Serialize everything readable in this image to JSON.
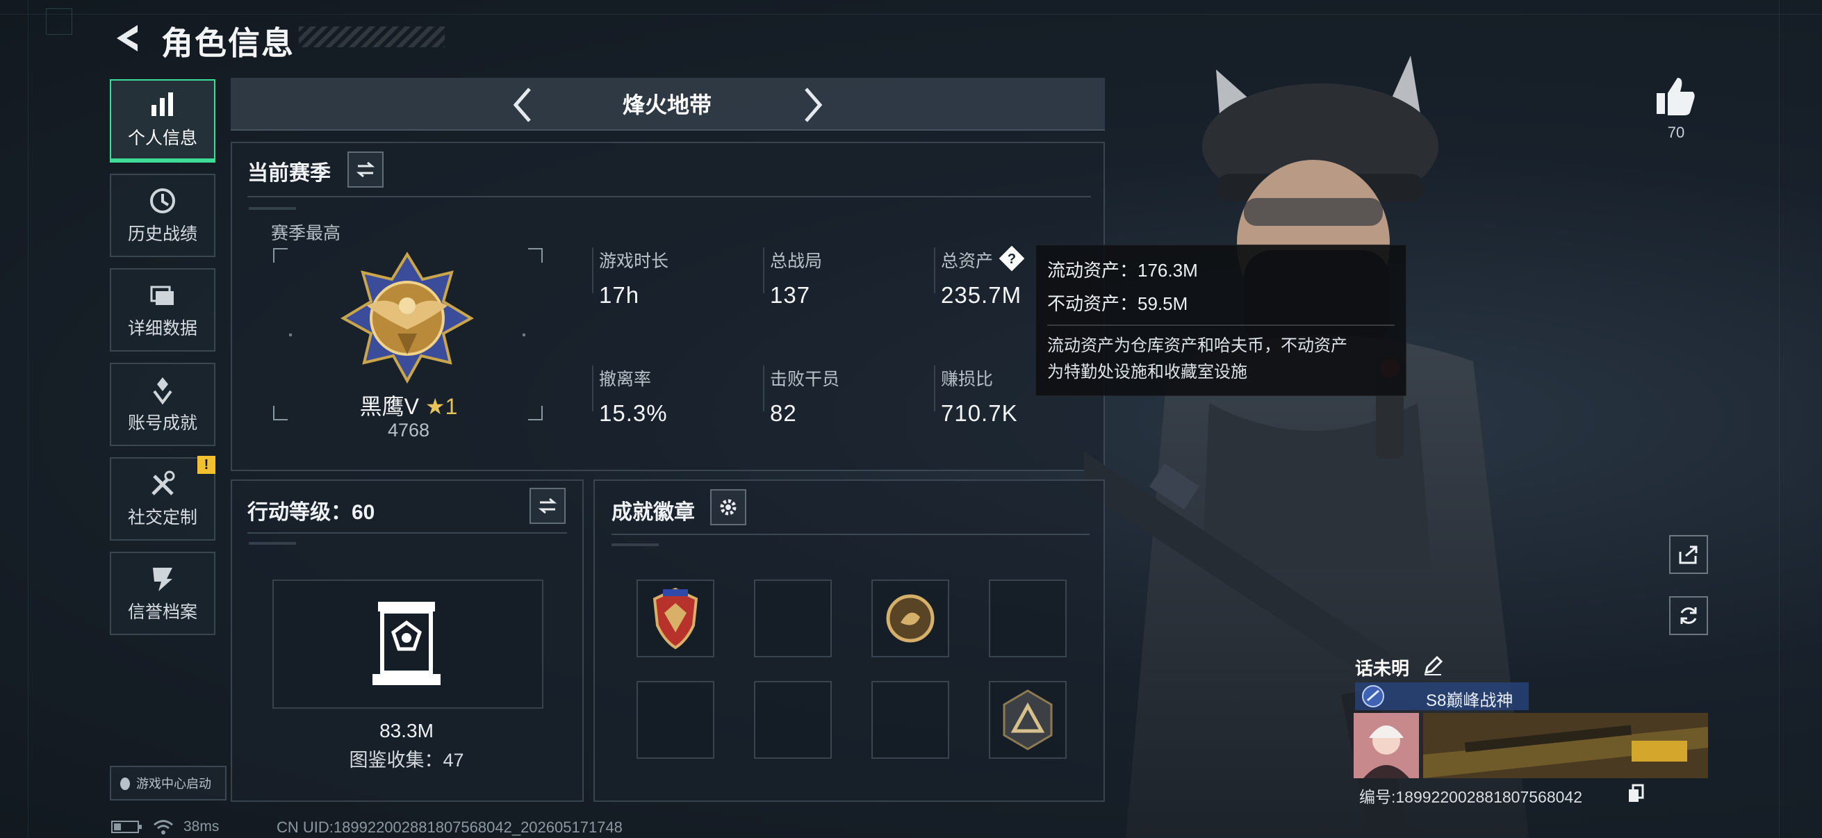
{
  "header": {
    "title": "角色信息"
  },
  "nav": {
    "items": [
      {
        "label": "个人信息",
        "icon": "bar-chart-icon"
      },
      {
        "label": "历史战绩",
        "icon": "history-clock-icon"
      },
      {
        "label": "详细数据",
        "icon": "folders-icon"
      },
      {
        "label": "账号成就",
        "icon": "achievement-icon"
      },
      {
        "label": "社交定制",
        "icon": "tools-icon"
      },
      {
        "label": "信誉档案",
        "icon": "credit-icon"
      }
    ],
    "badge": "!",
    "launch_label": "游戏中心启动"
  },
  "mode": {
    "name": "烽火地带"
  },
  "season": {
    "title": "当前赛季",
    "best_label": "赛季最高",
    "rank_name": "黑鹰V",
    "rank_stars": "★1",
    "rank_score": "4768",
    "stats": [
      {
        "label": "游戏时长",
        "value": "17h"
      },
      {
        "label": "总战局",
        "value": "137"
      },
      {
        "label": "总资产",
        "value": "235.7M"
      },
      {
        "label": "撤离率",
        "value": "15.3%"
      },
      {
        "label": "击败干员",
        "value": "82"
      },
      {
        "label": "赚损比",
        "value": "710.7K"
      }
    ]
  },
  "tooltip": {
    "liquid": "流动资产：176.3M",
    "fixed": "不动资产：59.5M",
    "desc_line1": "流动资产为仓库资产和哈夫币，不动资产",
    "desc_line2": "为特勤处设施和收藏室设施"
  },
  "rank_panel": {
    "title": "行动等级：60",
    "value": "83.3M",
    "collection": "图鉴收集：47"
  },
  "badges": {
    "title": "成就徽章"
  },
  "right": {
    "like_count": "70"
  },
  "profile": {
    "name": "话未明",
    "title_chip": "S8巅峰战神",
    "player_id": "编号:1899220028818075680​42"
  },
  "status": {
    "ping": "38ms",
    "uid": "CN UID:1899220028818075680​42_202605171748"
  },
  "colors": {
    "accent": "#3ddc97",
    "warning": "#f2c12e",
    "title_chip": "#2a4680"
  }
}
